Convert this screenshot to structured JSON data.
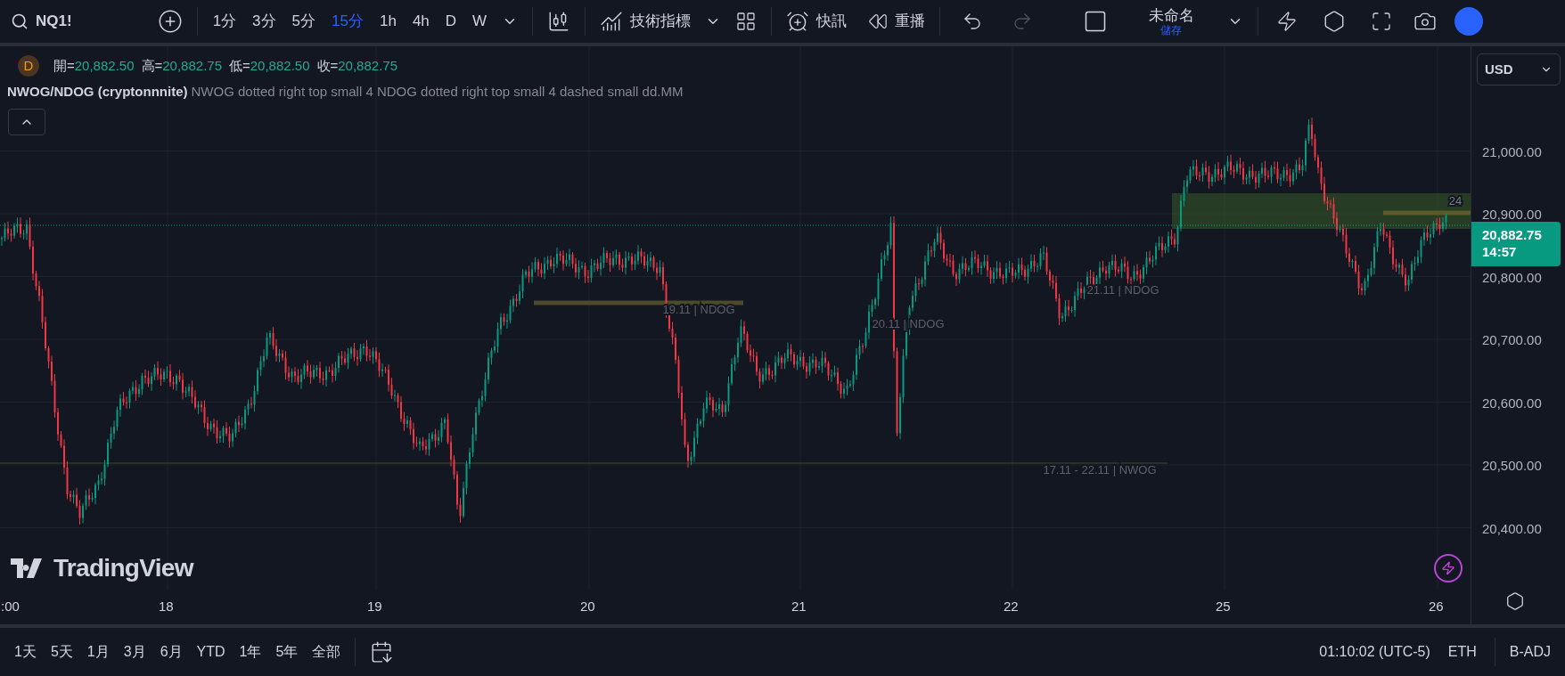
{
  "toolbar": {
    "symbol": "NQ1!",
    "intervals": [
      {
        "label": "1分",
        "selected": false
      },
      {
        "label": "3分",
        "selected": false
      },
      {
        "label": "5分",
        "selected": false
      },
      {
        "label": "15分",
        "selected": true
      },
      {
        "label": "1h",
        "selected": false
      },
      {
        "label": "4h",
        "selected": false
      },
      {
        "label": "D",
        "selected": false
      },
      {
        "label": "W",
        "selected": false
      }
    ],
    "indicators_label": "技術指標",
    "alert_label": "快訊",
    "replay_label": "重播",
    "undo": {
      "disabled": false
    },
    "redo": {
      "disabled": true
    },
    "layout_name": "未命名",
    "save_label": "儲存"
  },
  "legend": {
    "interval_badge": "D",
    "ohlc": [
      {
        "label": "開=",
        "value": "20,882.50"
      },
      {
        "label": "高=",
        "value": "20,882.75"
      },
      {
        "label": "低=",
        "value": "20,882.50"
      },
      {
        "label": "收=",
        "value": "20,882.75"
      }
    ],
    "indicator_name": "NWOG/NDOG (cryptonnnite)",
    "indicator_params": "NWOG dotted right top small 4 NDOG dotted right top small 4 dashed small dd.MM"
  },
  "chart": {
    "annotations": [
      "19.11 | NDOG",
      "20.11 | NDOG",
      "21.11 | NDOG",
      "17.11 - 22.11 | NWOG",
      "24"
    ],
    "time_labels": [
      ":00",
      "18",
      "19",
      "20",
      "21",
      "22",
      "25",
      "26"
    ],
    "currency": "USD",
    "price_labels": [
      "21,000.00",
      "20,900.00",
      "20,800.00",
      "20,700.00",
      "20,600.00",
      "20,500.00",
      "20,400.00"
    ],
    "last_price": "20,882.75",
    "countdown": "14:57",
    "brand": "TradingView"
  },
  "range_bar": {
    "ranges": [
      "1天",
      "5天",
      "1月",
      "3月",
      "6月",
      "YTD",
      "1年",
      "5年",
      "全部"
    ],
    "clock": "01:10:02 (UTC-5)",
    "session": "ETH",
    "adjustment": "B-ADJ"
  }
}
